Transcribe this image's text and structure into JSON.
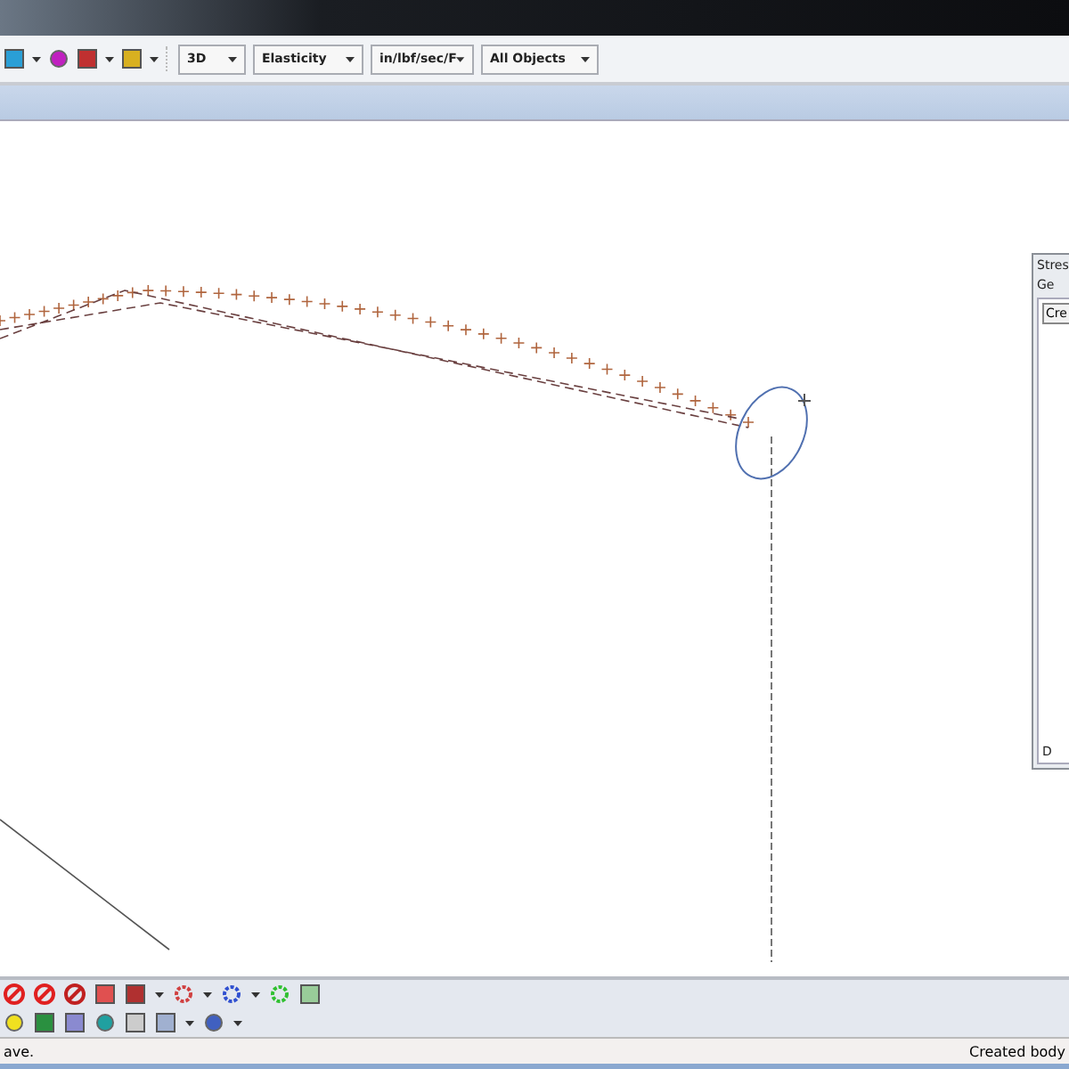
{
  "toolbar": {
    "dropdowns": [
      {
        "value": "3D"
      },
      {
        "value": "Elasticity"
      },
      {
        "value": "in/lbf/sec/F"
      },
      {
        "value": "All Objects"
      }
    ]
  },
  "dialog": {
    "title": "Stres",
    "tab": "Ge",
    "button": "Cre",
    "label": "D"
  },
  "status_bar": {
    "left": "ave.",
    "right": "Created body"
  }
}
